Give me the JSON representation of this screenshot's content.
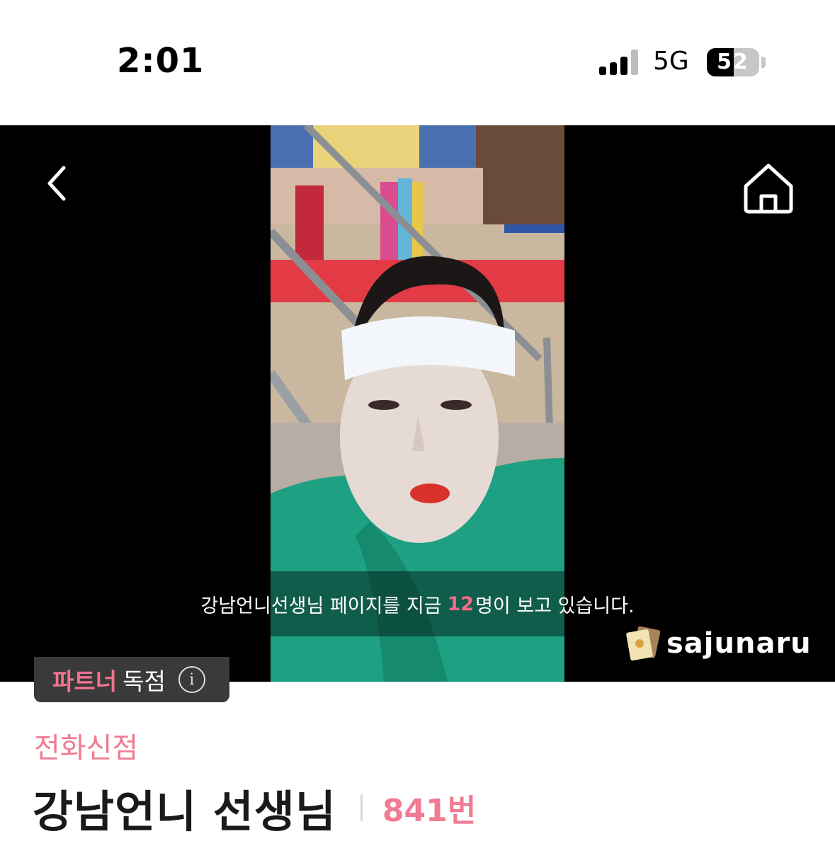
{
  "status_bar": {
    "time": "2:01",
    "network": "5G",
    "battery": "52",
    "battery_level_percent": 52
  },
  "hero": {
    "viewer_text_before": "강남언니선생님 페이지를 지금",
    "viewer_count": "12",
    "viewer_text_after": "명이 보고 있습니다.",
    "logo_text": "sajunaru",
    "accent_color": "#f36b8a"
  },
  "partner_badge": {
    "highlight": "파트너",
    "label": "독점",
    "info_icon": "i"
  },
  "profile": {
    "category": "전화신점",
    "name": "강남언니 선생님",
    "number": "841번"
  }
}
